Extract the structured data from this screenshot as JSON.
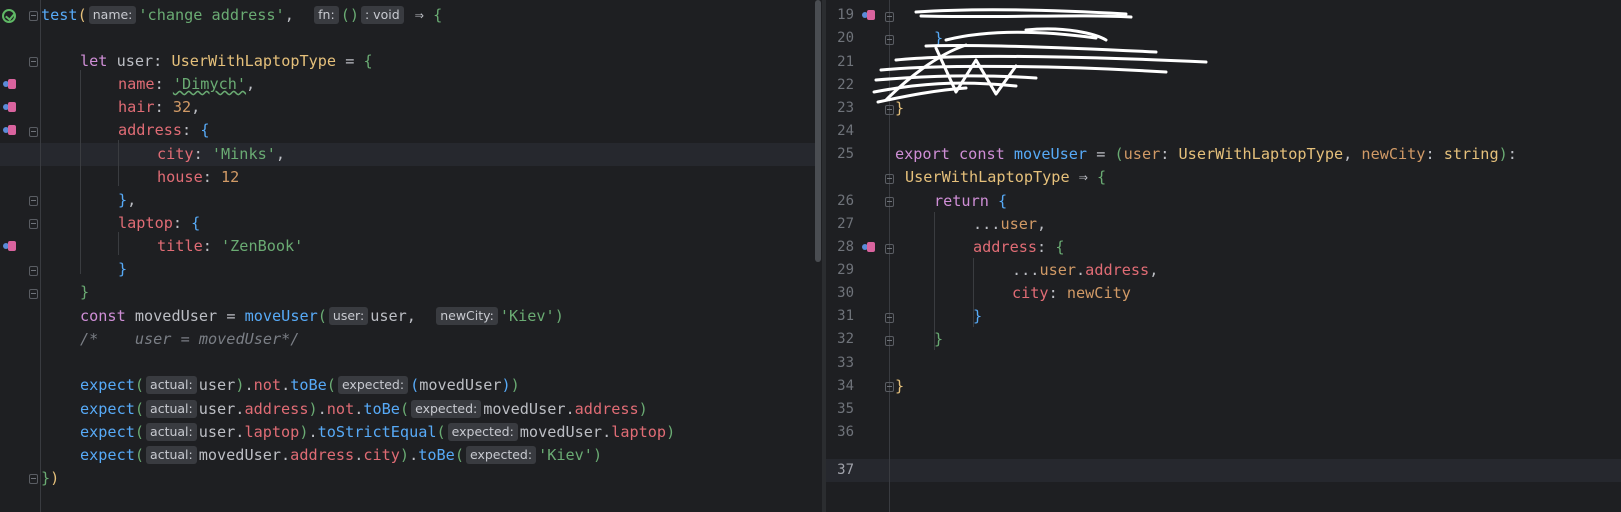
{
  "colors": {
    "background": "#1e1f22",
    "keyword": "#cf8ed6",
    "function": "#57aaf7",
    "string": "#6aab73",
    "property": "#e06c75",
    "type": "#e5c07b",
    "number": "#d19a66"
  },
  "left": {
    "test_name_hint": "name:",
    "test_name": "'change address'",
    "fn_hint": "fn:",
    "void_hint": ": void",
    "user_var": "user",
    "user_type": "UserWithLaptopType",
    "name_key": "name",
    "name_val": "'Dimych'",
    "hair_key": "hair",
    "hair_val": "32",
    "address_key": "address",
    "city_key": "city",
    "city_val": "'Minks'",
    "house_key": "house",
    "house_val": "12",
    "laptop_key": "laptop",
    "title_key": "title",
    "title_val": "'ZenBook'",
    "moved_var": "movedUser",
    "move_fn": "moveUser",
    "user_hint": "user:",
    "newcity_hint": "newCity:",
    "kiev": "'Kiev'",
    "comment": "/*    user = movedUser*/",
    "expect": "expect",
    "actual_hint": "actual:",
    "expected_hint": "expected:",
    "not": "not",
    "toBe": "toBe",
    "toStrictEqual": "toStrictEqual"
  },
  "right": {
    "line_numbers": [
      "19",
      "20",
      "21",
      "22",
      "23",
      "24",
      "25",
      "26",
      "27",
      "28",
      "29",
      "30",
      "31",
      "32",
      "33",
      "34",
      "35",
      "36",
      "37"
    ],
    "export_kw": "export",
    "const_kw": "const",
    "fn_name": "moveUser",
    "param_user": "user",
    "param_type": "UserWithLaptopType",
    "param_city": "newCity",
    "string_type": "string",
    "return_type": "UserWithLaptopType",
    "return_kw": "return",
    "spread_user": "...",
    "address_key": "address",
    "city_key": "city",
    "new_city": "newCity"
  }
}
